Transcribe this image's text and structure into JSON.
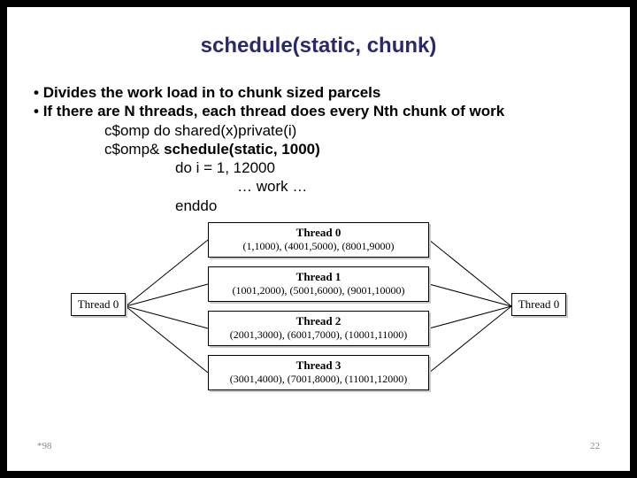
{
  "title": "schedule(static, chunk)",
  "bullets": [
    "Divides the work load in to chunk sized parcels",
    "If there are N threads, each thread does every Nth chunk of work"
  ],
  "code": {
    "line1": "c$omp do shared(x)private(i)",
    "line2_prefix": "c$omp& ",
    "line2_bold": "schedule(static, 1000)",
    "line3": "do i = 1, 12000",
    "line4": "… work …",
    "line5": "enddo"
  },
  "diagram": {
    "left_box": "Thread 0",
    "right_box": "Thread 0",
    "threads": [
      {
        "name": "Thread 0",
        "ranges": "(1,1000), (4001,5000), (8001,9000)"
      },
      {
        "name": "Thread 1",
        "ranges": "(1001,2000), (5001,6000), (9001,10000)"
      },
      {
        "name": "Thread 2",
        "ranges": "(2001,3000), (6001,7000), (10001,11000)"
      },
      {
        "name": "Thread 3",
        "ranges": "(3001,4000), (7001,8000), (11001,12000)"
      }
    ]
  },
  "footer": {
    "left": "*98",
    "right": "22"
  }
}
